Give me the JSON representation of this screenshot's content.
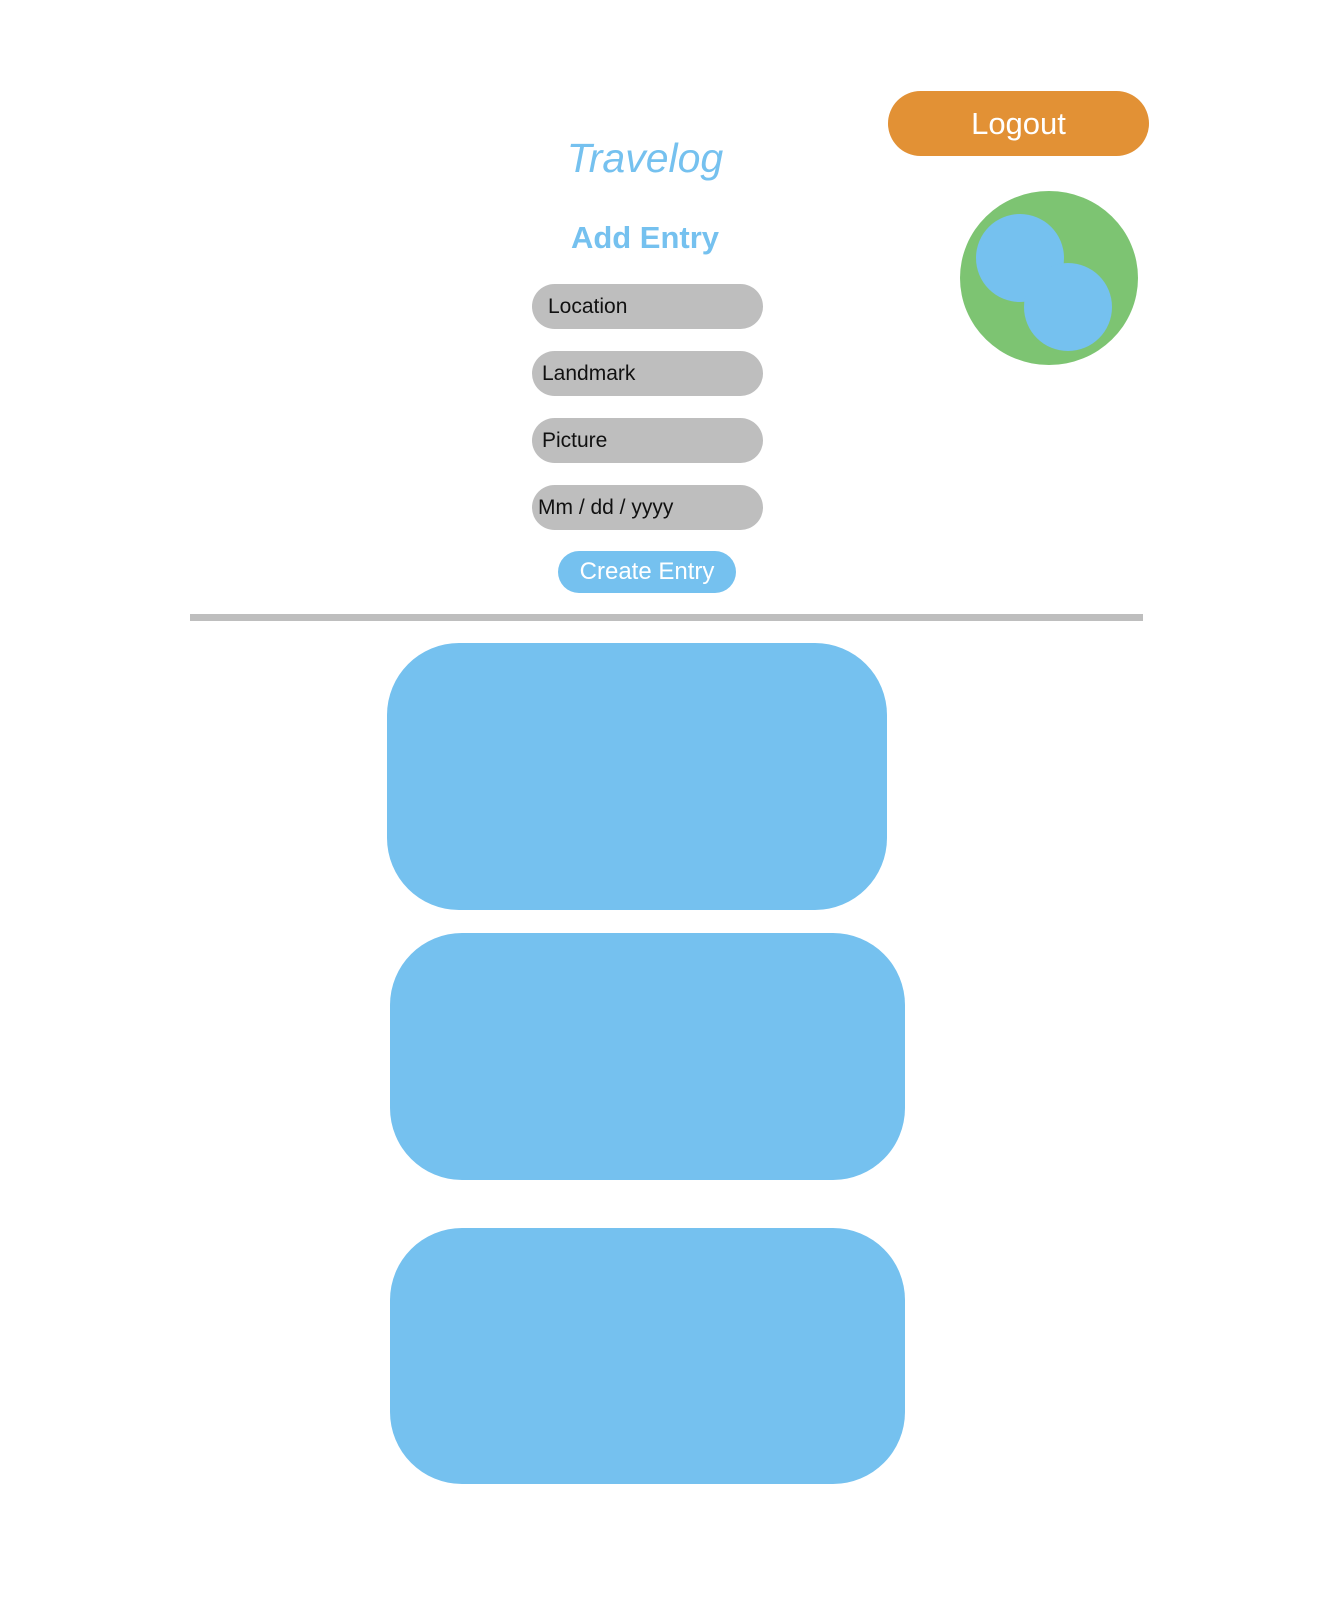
{
  "header": {
    "logout_label": "Logout",
    "app_title": "Travelog"
  },
  "form": {
    "title": "Add Entry",
    "location_placeholder": "Location",
    "landmark_placeholder": "Landmark",
    "picture_placeholder": "Picture",
    "date_placeholder": "Mm / dd / yyyy",
    "create_label": "Create Entry"
  },
  "entries": [
    {},
    {},
    {}
  ],
  "colors": {
    "accent_blue": "#75c1ef",
    "logout_orange": "#e29135",
    "avatar_green": "#7dc472",
    "field_gray": "#bebebe"
  },
  "icons": {
    "avatar": "user-avatar-icon"
  }
}
